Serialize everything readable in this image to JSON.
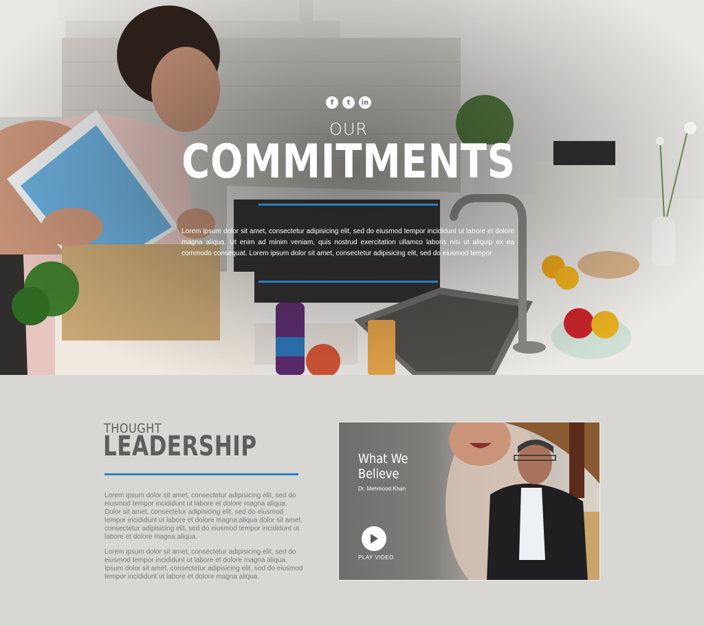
{
  "hero": {
    "social": [
      {
        "icon": "facebook-icon",
        "glyph": "f"
      },
      {
        "icon": "twitter-icon",
        "glyph": "t"
      },
      {
        "icon": "linkedin-icon",
        "glyph": "in"
      }
    ],
    "kicker": "OUR",
    "title": "COMMITMENTS",
    "body": "Lorem ipsum dolor sit amet, consectetur adipisicing elit, sed do eiusmod tempor incididunt ut labore et dolore magna aliqua. Ut enim ad minim veniam, quis nostrud exercitation ullamco laboris nisi ut aliquip ex ea commodo consequat. Lorem ipsum dolor sit amet, consectetur adipisicing elit, sed do eiusmod tempor"
  },
  "thought": {
    "kicker": "THOUGHT",
    "title": "LEADERSHIP",
    "p1": "Lorem ipsum dolor sit amet, consectetur adipisicing elit, sed do eiusmod tempor incididunt ut labore et dolore magna aliqua. Dolor sit amet, consectetur adipisicing elit, sed do eiusmod tempor incididunt ut labore et dolore magna aliqua dolor sit amet, consectetur adipisicing elit, sed do eiusmod tempor incididunt ut labore et dolore magna aliqua.",
    "p2": "Lorem ipsum dolor sit amet, consectetur adipisicing elit, sed do eiusmod tempor incididunt ut labore et dolore magna aliqua. Ipsum dolor sit amet, consectetur adipisicing elit, sed do eiusmod tempor incididunt ut labore et dolore magna aliqua."
  },
  "video": {
    "title": "What We Believe",
    "author": "Dr. Mehmood Khan",
    "play_label": "PLAY VIDEO"
  },
  "colors": {
    "accent": "#2a7fc6",
    "background": "#d8d7d4",
    "heading": "#5e5e5e",
    "body_text": "#7a7a7a"
  }
}
